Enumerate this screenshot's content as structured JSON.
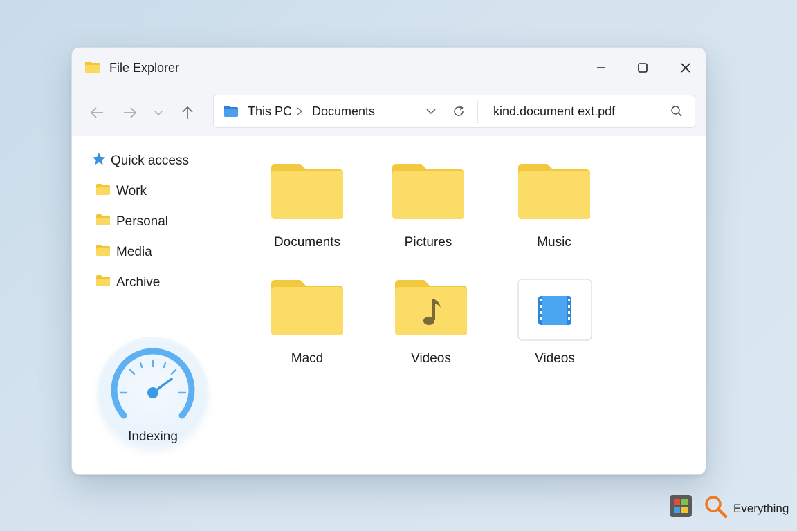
{
  "window": {
    "title": "File Explorer"
  },
  "window_controls": {
    "minimize": "minimize-icon",
    "maximize": "maximize-icon",
    "close": "close-icon"
  },
  "navigation": {
    "back": "back-arrow-icon",
    "forward": "forward-arrow-icon",
    "recent": "chevron-down-icon",
    "up": "up-arrow-icon"
  },
  "address": {
    "crumbs": [
      "This PC",
      "Documents"
    ],
    "search_value": "kind.document ext.pdf"
  },
  "sidebar": {
    "quick_access": "Quick access",
    "items": [
      {
        "label": "Work",
        "icon": "folder-icon"
      },
      {
        "label": "Personal",
        "icon": "folder-icon"
      },
      {
        "label": "Media",
        "icon": "folder-icon"
      },
      {
        "label": "Archive",
        "icon": "folder-icon"
      }
    ],
    "indexing_label": "Indexing"
  },
  "content": {
    "items": [
      {
        "label": "Documents",
        "icon": "folder-icon"
      },
      {
        "label": "Pictures",
        "icon": "folder-icon"
      },
      {
        "label": "Music",
        "icon": "folder-icon"
      },
      {
        "label": "Macd",
        "icon": "folder-icon"
      },
      {
        "label": "Videos",
        "icon": "music-folder-icon"
      },
      {
        "label": "Videos",
        "icon": "video-file-icon"
      }
    ]
  },
  "taskbar": {
    "everything_label": "Everything"
  },
  "colors": {
    "folder": "#f9d65c",
    "accent": "#3b8fe0",
    "gauge": "#5db1f2"
  }
}
